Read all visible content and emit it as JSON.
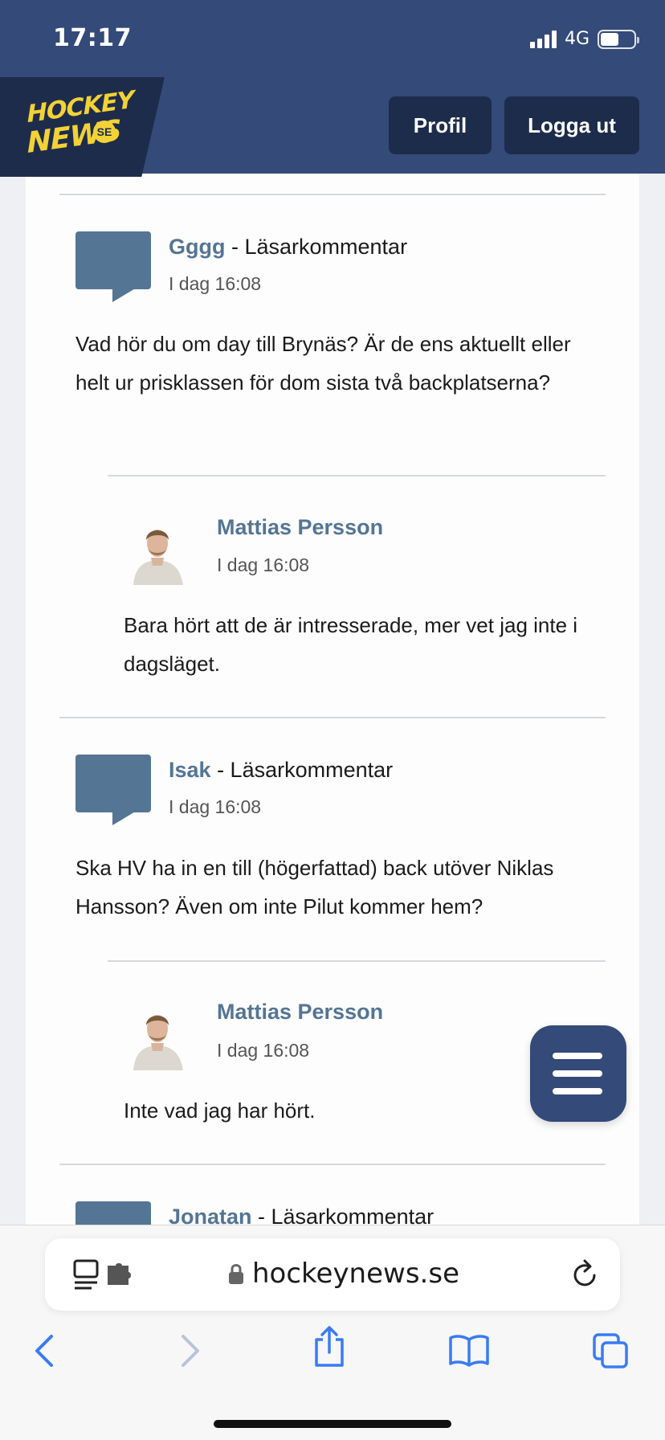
{
  "status_bar": {
    "time": "17:17",
    "network": "4G"
  },
  "header": {
    "logo_line1": "HOCKEY",
    "logo_line2": "NEWS",
    "logo_badge": "SE",
    "profile_button": "Profil",
    "logout_button": "Logga ut"
  },
  "comments": [
    {
      "name": "Gggg",
      "tag": " - Läsarkommentar",
      "time": "I dag 16:08",
      "text": "Vad hör du om day till Brynäs? Är de ens aktuellt eller helt ur prisklassen för dom sista två backplatserna?",
      "reply": {
        "name": "Mattias Persson",
        "time": "I dag 16:08",
        "text": "Bara hört att de är intresserade, mer vet jag inte i dagsläget."
      }
    },
    {
      "name": "Isak",
      "tag": " - Läsarkommentar",
      "time": "I dag 16:08",
      "text": "Ska HV ha in en till (högerfattad) back utöver Niklas Hansson? Även om inte Pilut kommer hem?",
      "reply": {
        "name": "Mattias Persson",
        "time": "I dag 16:08",
        "text": "Inte vad jag har hört."
      }
    },
    {
      "name": "Jonatan",
      "tag": " - Läsarkommentar"
    }
  ],
  "browser": {
    "url": "hockeynews.se"
  },
  "colors": {
    "brand_navy": "#344a78",
    "dark_navy": "#1e2c4c",
    "accent_yellow": "#f2d235",
    "comment_blue": "#547594"
  }
}
